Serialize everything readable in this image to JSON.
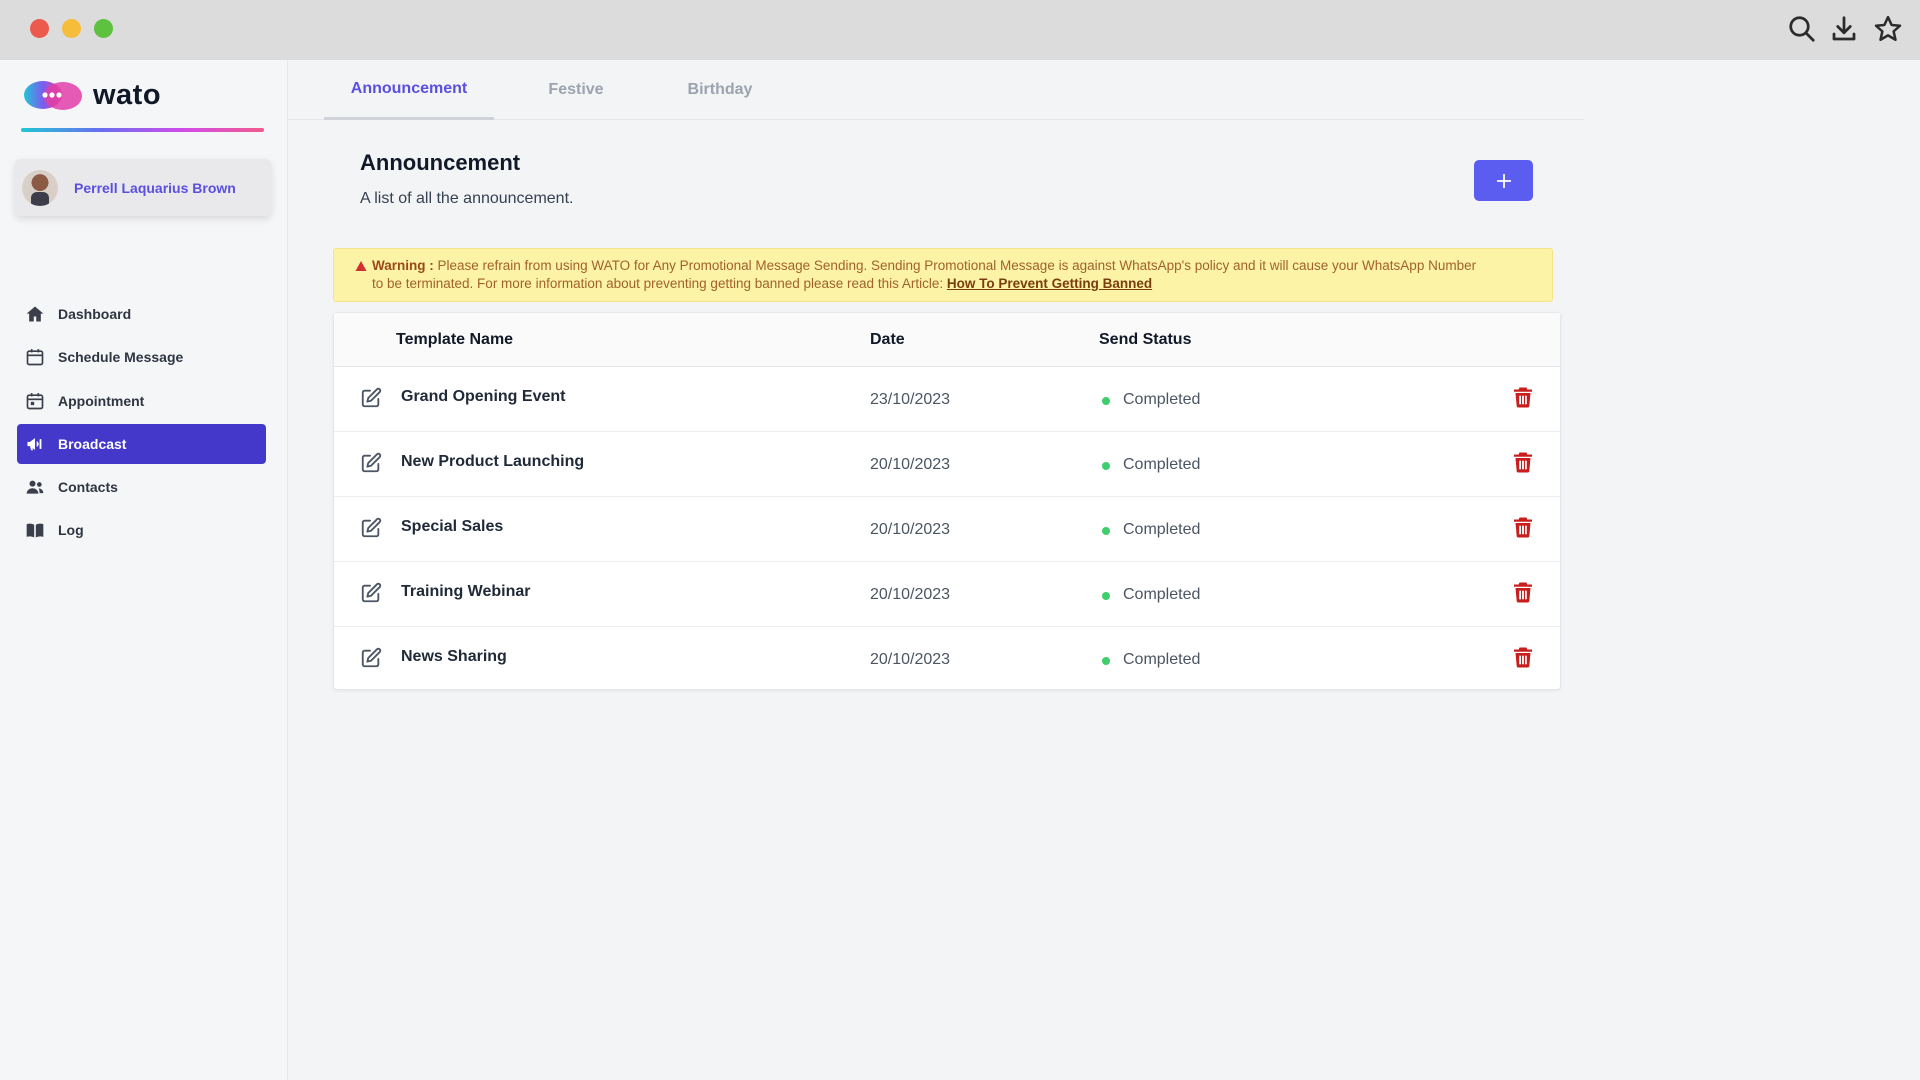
{
  "brand": {
    "name": "wato"
  },
  "user": {
    "name": "Perrell Laquarius Brown"
  },
  "sidebar": {
    "items": [
      {
        "label": "Dashboard",
        "icon": "home-icon",
        "active": false
      },
      {
        "label": "Schedule Message",
        "icon": "calendar-icon",
        "active": false
      },
      {
        "label": "Appointment",
        "icon": "appointment-calendar-icon",
        "active": false
      },
      {
        "label": "Broadcast",
        "icon": "megaphone-icon",
        "active": true
      },
      {
        "label": "Contacts",
        "icon": "users-icon",
        "active": false
      },
      {
        "label": "Log",
        "icon": "book-icon",
        "active": false
      }
    ]
  },
  "tabs": [
    {
      "label": "Announcement",
      "active": true
    },
    {
      "label": "Festive",
      "active": false
    },
    {
      "label": "Birthday",
      "active": false
    }
  ],
  "header": {
    "title": "Announcement",
    "subtitle": "A list of all the announcement."
  },
  "warning": {
    "prefix": "Warning :",
    "text_line1": "Please refrain from using WATO for Any Promotional Message Sending. Sending Promotional Message is against WhatsApp's policy and it will cause your WhatsApp Number",
    "text_line2": "to be terminated. For more information about preventing getting banned please read this Article:",
    "link": "How To Prevent Getting Banned"
  },
  "table": {
    "columns": {
      "name": "Template Name",
      "date": "Date",
      "status": "Send Status"
    },
    "rows": [
      {
        "name": "Grand Opening Event",
        "date": "23/10/2023",
        "status": "Completed"
      },
      {
        "name": "New Product Launching",
        "date": "20/10/2023",
        "status": "Completed"
      },
      {
        "name": "Special Sales",
        "date": "20/10/2023",
        "status": "Completed"
      },
      {
        "name": "Training Webinar",
        "date": "20/10/2023",
        "status": "Completed"
      },
      {
        "name": "News Sharing",
        "date": "20/10/2023",
        "status": "Completed"
      }
    ]
  },
  "colors": {
    "accent": "#4338ca",
    "primary_button": "#5b5cf0",
    "warning_bg": "#fcf3a6",
    "status_completed": "#3ecf6c",
    "delete": "#c81e1e"
  }
}
